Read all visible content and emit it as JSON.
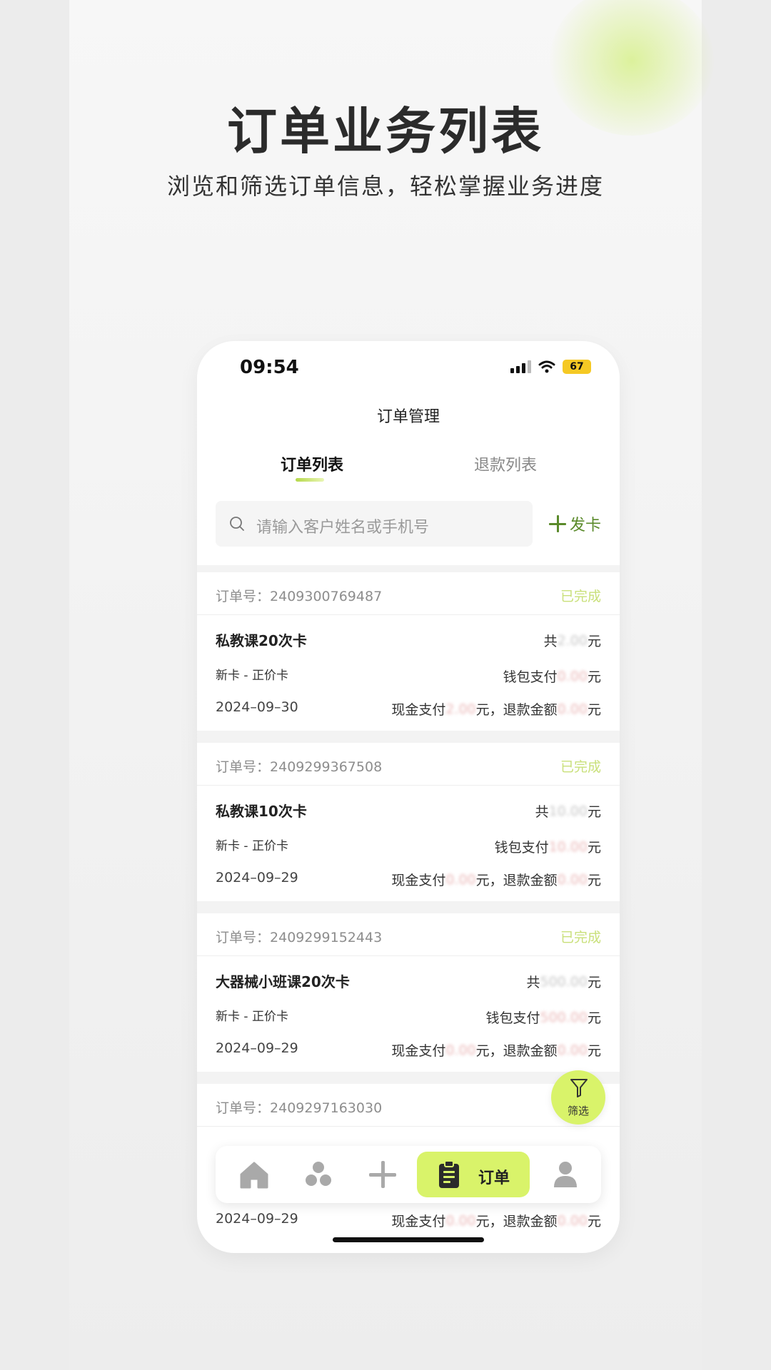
{
  "hero": {
    "title": "订单业务列表",
    "subtitle": "浏览和筛选订单信息，轻松掌握业务进度"
  },
  "status_bar": {
    "time": "09:54",
    "battery": "67"
  },
  "nav": {
    "title": "订单管理"
  },
  "tabs": [
    {
      "label": "订单列表",
      "active": true
    },
    {
      "label": "退款列表",
      "active": false
    }
  ],
  "search": {
    "placeholder": "请输入客户姓名或手机号",
    "icon": "search-icon"
  },
  "add_card": {
    "label": "发卡",
    "icon": "plus-icon"
  },
  "orders": [
    {
      "order_label": "订单号：",
      "order_no": "2409300769487",
      "status": "已完成",
      "product": "私教课20次卡",
      "card_type": "新卡 - 正价卡",
      "date": "2024–09–30",
      "total_prefix": "共",
      "total": "2.00",
      "total_suffix": "元",
      "wallet_prefix": "钱包支付",
      "wallet": "0.00",
      "wallet_suffix": "元",
      "cash_prefix": "现金支付",
      "cash": "2.00",
      "cash_mid": "元，退款金额",
      "refund": "0.00",
      "refund_suffix": "元"
    },
    {
      "order_label": "订单号：",
      "order_no": "2409299367508",
      "status": "已完成",
      "product": "私教课10次卡",
      "card_type": "新卡 - 正价卡",
      "date": "2024–09–29",
      "total_prefix": "共",
      "total": "10.00",
      "total_suffix": "元",
      "wallet_prefix": "钱包支付",
      "wallet": "10.00",
      "wallet_suffix": "元",
      "cash_prefix": "现金支付",
      "cash": "0.00",
      "cash_mid": "元，退款金额",
      "refund": "0.00",
      "refund_suffix": "元"
    },
    {
      "order_label": "订单号：",
      "order_no": "2409299152443",
      "status": "已完成",
      "product": "大器械小班课20次卡",
      "card_type": "新卡 - 正价卡",
      "date": "2024–09–29",
      "total_prefix": "共",
      "total": "500.00",
      "total_suffix": "元",
      "wallet_prefix": "钱包支付",
      "wallet": "500.00",
      "wallet_suffix": "元",
      "cash_prefix": "现金支付",
      "cash": "0.00",
      "cash_mid": "元，退款金额",
      "refund": "0.00",
      "refund_suffix": "元"
    },
    {
      "order_label": "订单号：",
      "order_no": "2409297163030",
      "date": "2024–09–29",
      "cash_prefix": "现金支付",
      "cash": "0.00",
      "cash_mid": "元，退款金额",
      "refund": "0.00",
      "refund_suffix": "元"
    }
  ],
  "fab": {
    "label": "筛选",
    "icon": "filter-icon"
  },
  "tabbar": {
    "items": [
      {
        "icon": "home-icon"
      },
      {
        "icon": "members-icon"
      },
      {
        "icon": "add-icon"
      },
      {
        "icon": "order-clipboard-icon",
        "label": "订单",
        "active": true
      },
      {
        "icon": "profile-icon"
      }
    ]
  },
  "colors": {
    "accent": "#d9f36a",
    "status_done": "#c9e07a",
    "add_green": "#5a8a2a"
  }
}
